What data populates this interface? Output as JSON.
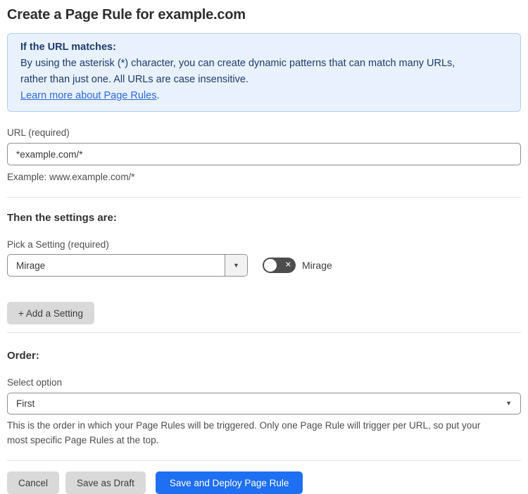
{
  "page": {
    "title": "Create a Page Rule for example.com"
  },
  "info_banner": {
    "heading": "If the URL matches:",
    "body_line1": "By using the asterisk (*) character, you can create dynamic patterns that can match many URLs,",
    "body_line2": "rather than just one. All URLs are case insensitive.",
    "link_label": "Learn more about Page Rules",
    "link_suffix": "."
  },
  "url_field": {
    "label": "URL (required)",
    "value": "*example.com/*",
    "helper": "Example: www.example.com/*"
  },
  "settings_section": {
    "heading": "Then the settings are:",
    "picker_label": "Pick a Setting (required)",
    "picker_value": "Mirage",
    "toggle_label": "Mirage",
    "toggle_state": "off",
    "add_button_label": "+ Add a Setting"
  },
  "order_section": {
    "heading": "Order:",
    "select_label": "Select option",
    "select_value": "First",
    "helper_line1": "This is the order in which your Page Rules will be triggered. Only one Page Rule will trigger per URL, so put your",
    "helper_line2": "most specific Page Rules at the top."
  },
  "footer": {
    "cancel_label": "Cancel",
    "save_draft_label": "Save as Draft",
    "save_deploy_label": "Save and Deploy Page Rule"
  },
  "icons": {
    "chevron_down": "▼",
    "close_x": "✕"
  },
  "colors": {
    "primary_blue": "#1f6ff2",
    "info_background": "#e8f1fd",
    "info_border": "#b0d0f2",
    "info_text": "#1f3c70",
    "link_blue": "#2f6bdb",
    "gray_button": "#d9d9d9",
    "toggle_off": "#4d4d4d"
  }
}
